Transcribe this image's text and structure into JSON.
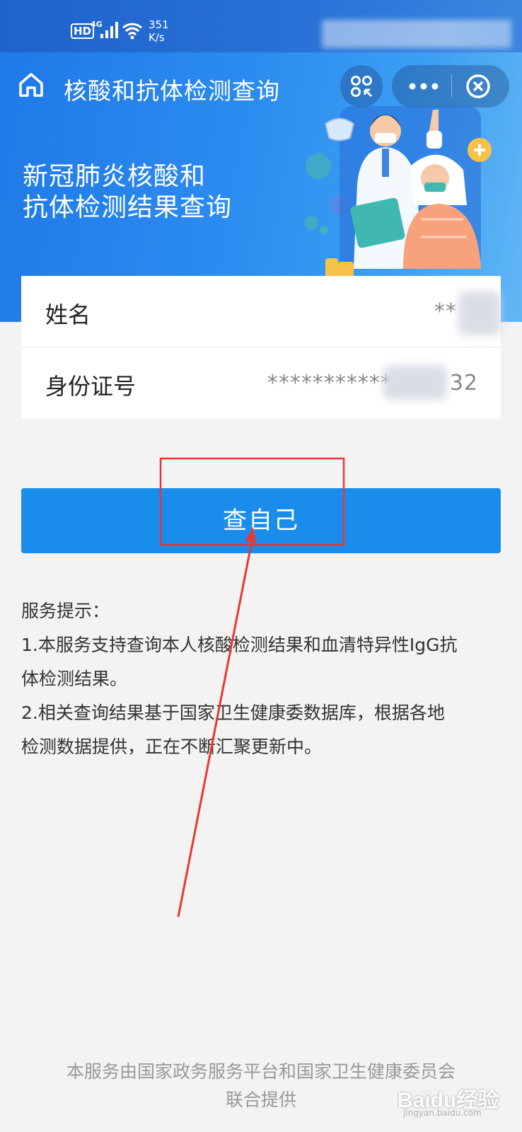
{
  "status_bar": {
    "hd": "HD",
    "network": "4G",
    "speed": "351\nK/s"
  },
  "header": {
    "title": "核酸和抗体检测查询",
    "hero_line1": "新冠肺炎核酸和",
    "hero_line2": "抗体检测结果查询"
  },
  "form": {
    "name_label": "姓名",
    "name_value": "**",
    "id_label": "身份证号",
    "id_value": "***********",
    "id_suffix": "32"
  },
  "button": {
    "label": "查自己"
  },
  "tips": {
    "heading": "服务提示：",
    "line1": "1.本服务支持查询本人核酸检测结果和血清特异性IgG抗",
    "line1b": "体检测结果。",
    "line2": "2.相关查询结果基于国家卫生健康委数据库，根据各地",
    "line2b": "检测数据提供，正在不断汇聚更新中。"
  },
  "footer": {
    "line1": "本服务由国家政务服务平台和国家卫生健康委员会",
    "line2": "联合提供"
  },
  "watermark": {
    "text": "Baidu经验",
    "sub": "jingyan.baidu.com"
  },
  "colors": {
    "primary": "#1a8cec",
    "banner": "#2b8bf0",
    "annotation": "#e53935"
  }
}
